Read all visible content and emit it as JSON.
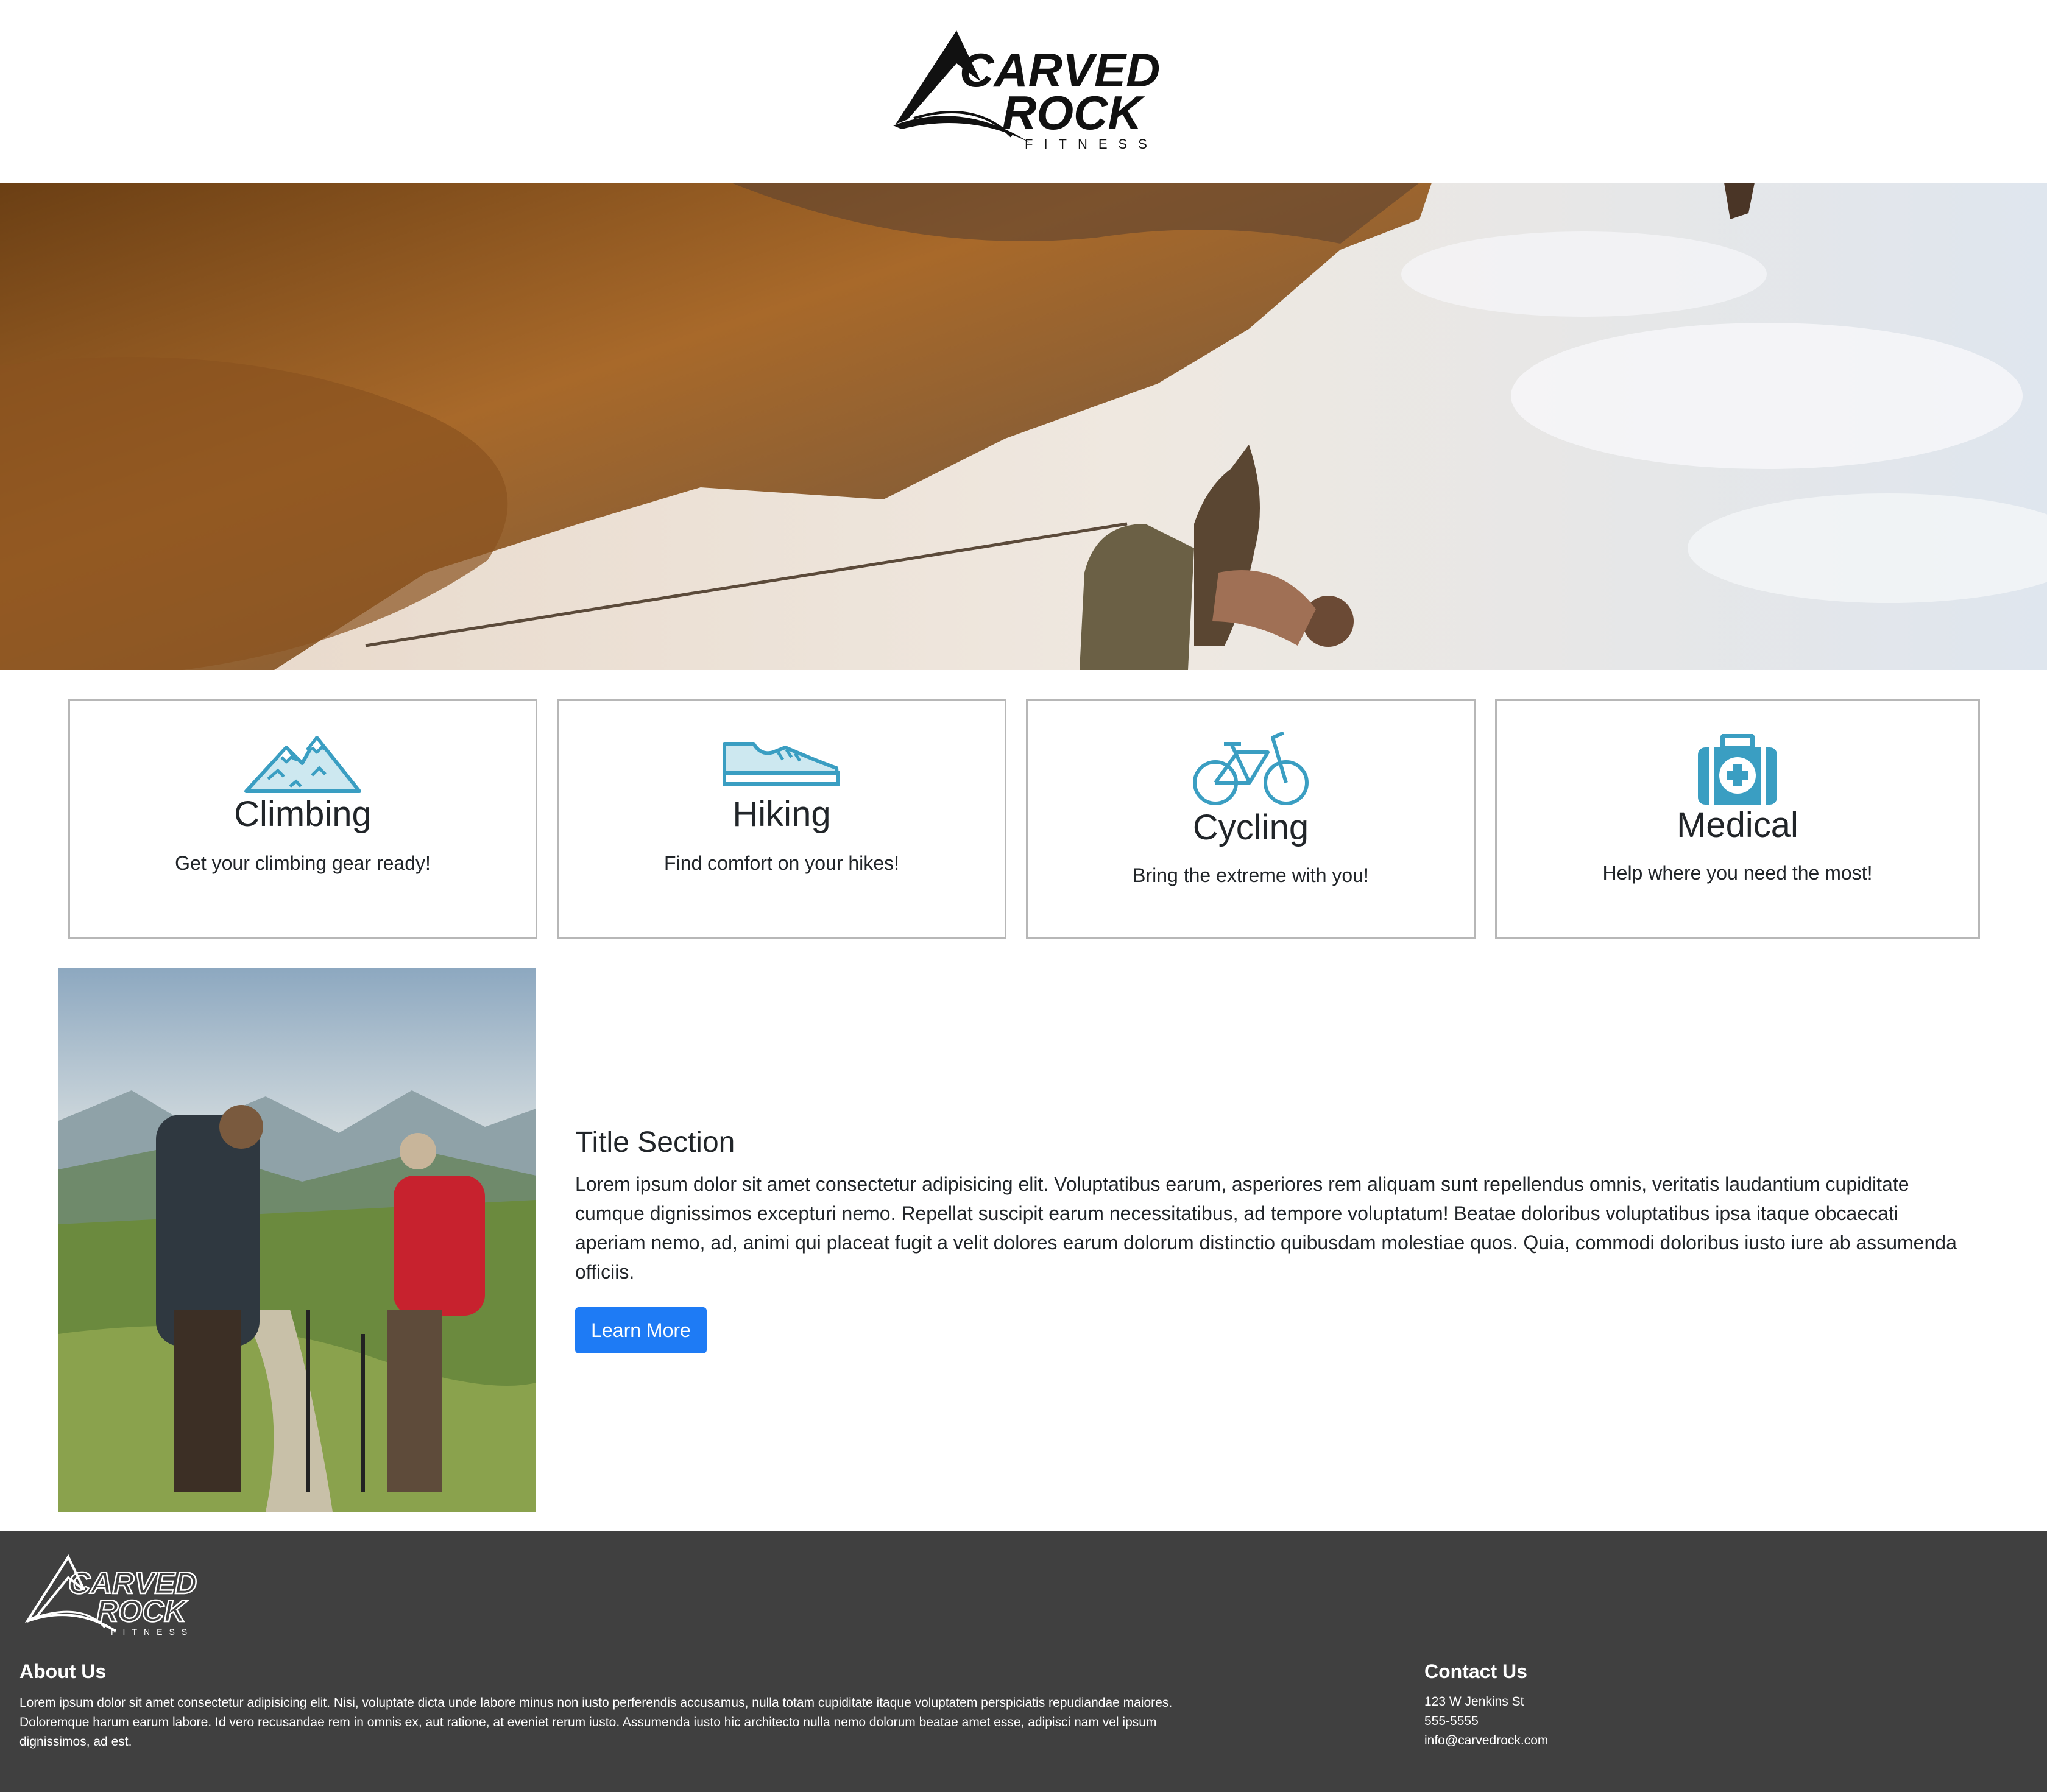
{
  "brand": {
    "logo_name": "carved-rock-fitness-logo",
    "logo_line1": "CARVED",
    "logo_line2": "ROCK",
    "logo_tagline": "FITNESS"
  },
  "hero": {
    "image": "rock-climber-overhang"
  },
  "colors": {
    "icon_accent": "#3a9ec2",
    "button": "#1e7bf5",
    "footer_bg": "#404040",
    "card_border": "#b7b7b7"
  },
  "features": [
    {
      "icon": "mountains-icon",
      "title": "Climbing",
      "text": "Get your climbing gear ready!"
    },
    {
      "icon": "shoe-icon",
      "title": "Hiking",
      "text": "Find comfort on your hikes!"
    },
    {
      "icon": "bicycle-icon",
      "title": "Cycling",
      "text": "Bring the extreme with you!"
    },
    {
      "icon": "first-aid-kit-icon",
      "title": "Medical",
      "text": "Help where you need the most!"
    }
  ],
  "content": {
    "image": "hikers-with-backpacks",
    "title": "Title Section",
    "body": "Lorem ipsum dolor sit amet consectetur adipisicing elit. Voluptatibus earum, asperiores rem aliquam sunt repellendus omnis, veritatis laudantium cupiditate cumque dignissimos excepturi nemo. Repellat suscipit earum necessitatibus, ad tempore voluptatum! Beatae doloribus voluptatibus ipsa itaque obcaecati aperiam nemo, ad, animi qui placeat fugit a velit dolores earum dolorum distinctio quibusdam molestiae quos. Quia, commodi doloribus iusto iure ab assumenda officiis.",
    "button_label": "Learn More"
  },
  "footer": {
    "about_title": "About Us",
    "about_text": "Lorem ipsum dolor sit amet consectetur adipisicing elit. Nisi, voluptate dicta unde labore minus non iusto perferendis accusamus, nulla totam cupiditate itaque voluptatem perspiciatis repudiandae maiores. Doloremque harum earum labore. Id vero recusandae rem in omnis ex, aut ratione, at eveniet rerum iusto. Assumenda iusto hic architecto nulla nemo dolorum beatae amet esse, adipisci nam vel ipsum dignissimos, ad est.",
    "contact_title": "Contact Us",
    "address": "123 W Jenkins St",
    "phone": "555-5555",
    "email": "info@carvedrock.com"
  }
}
